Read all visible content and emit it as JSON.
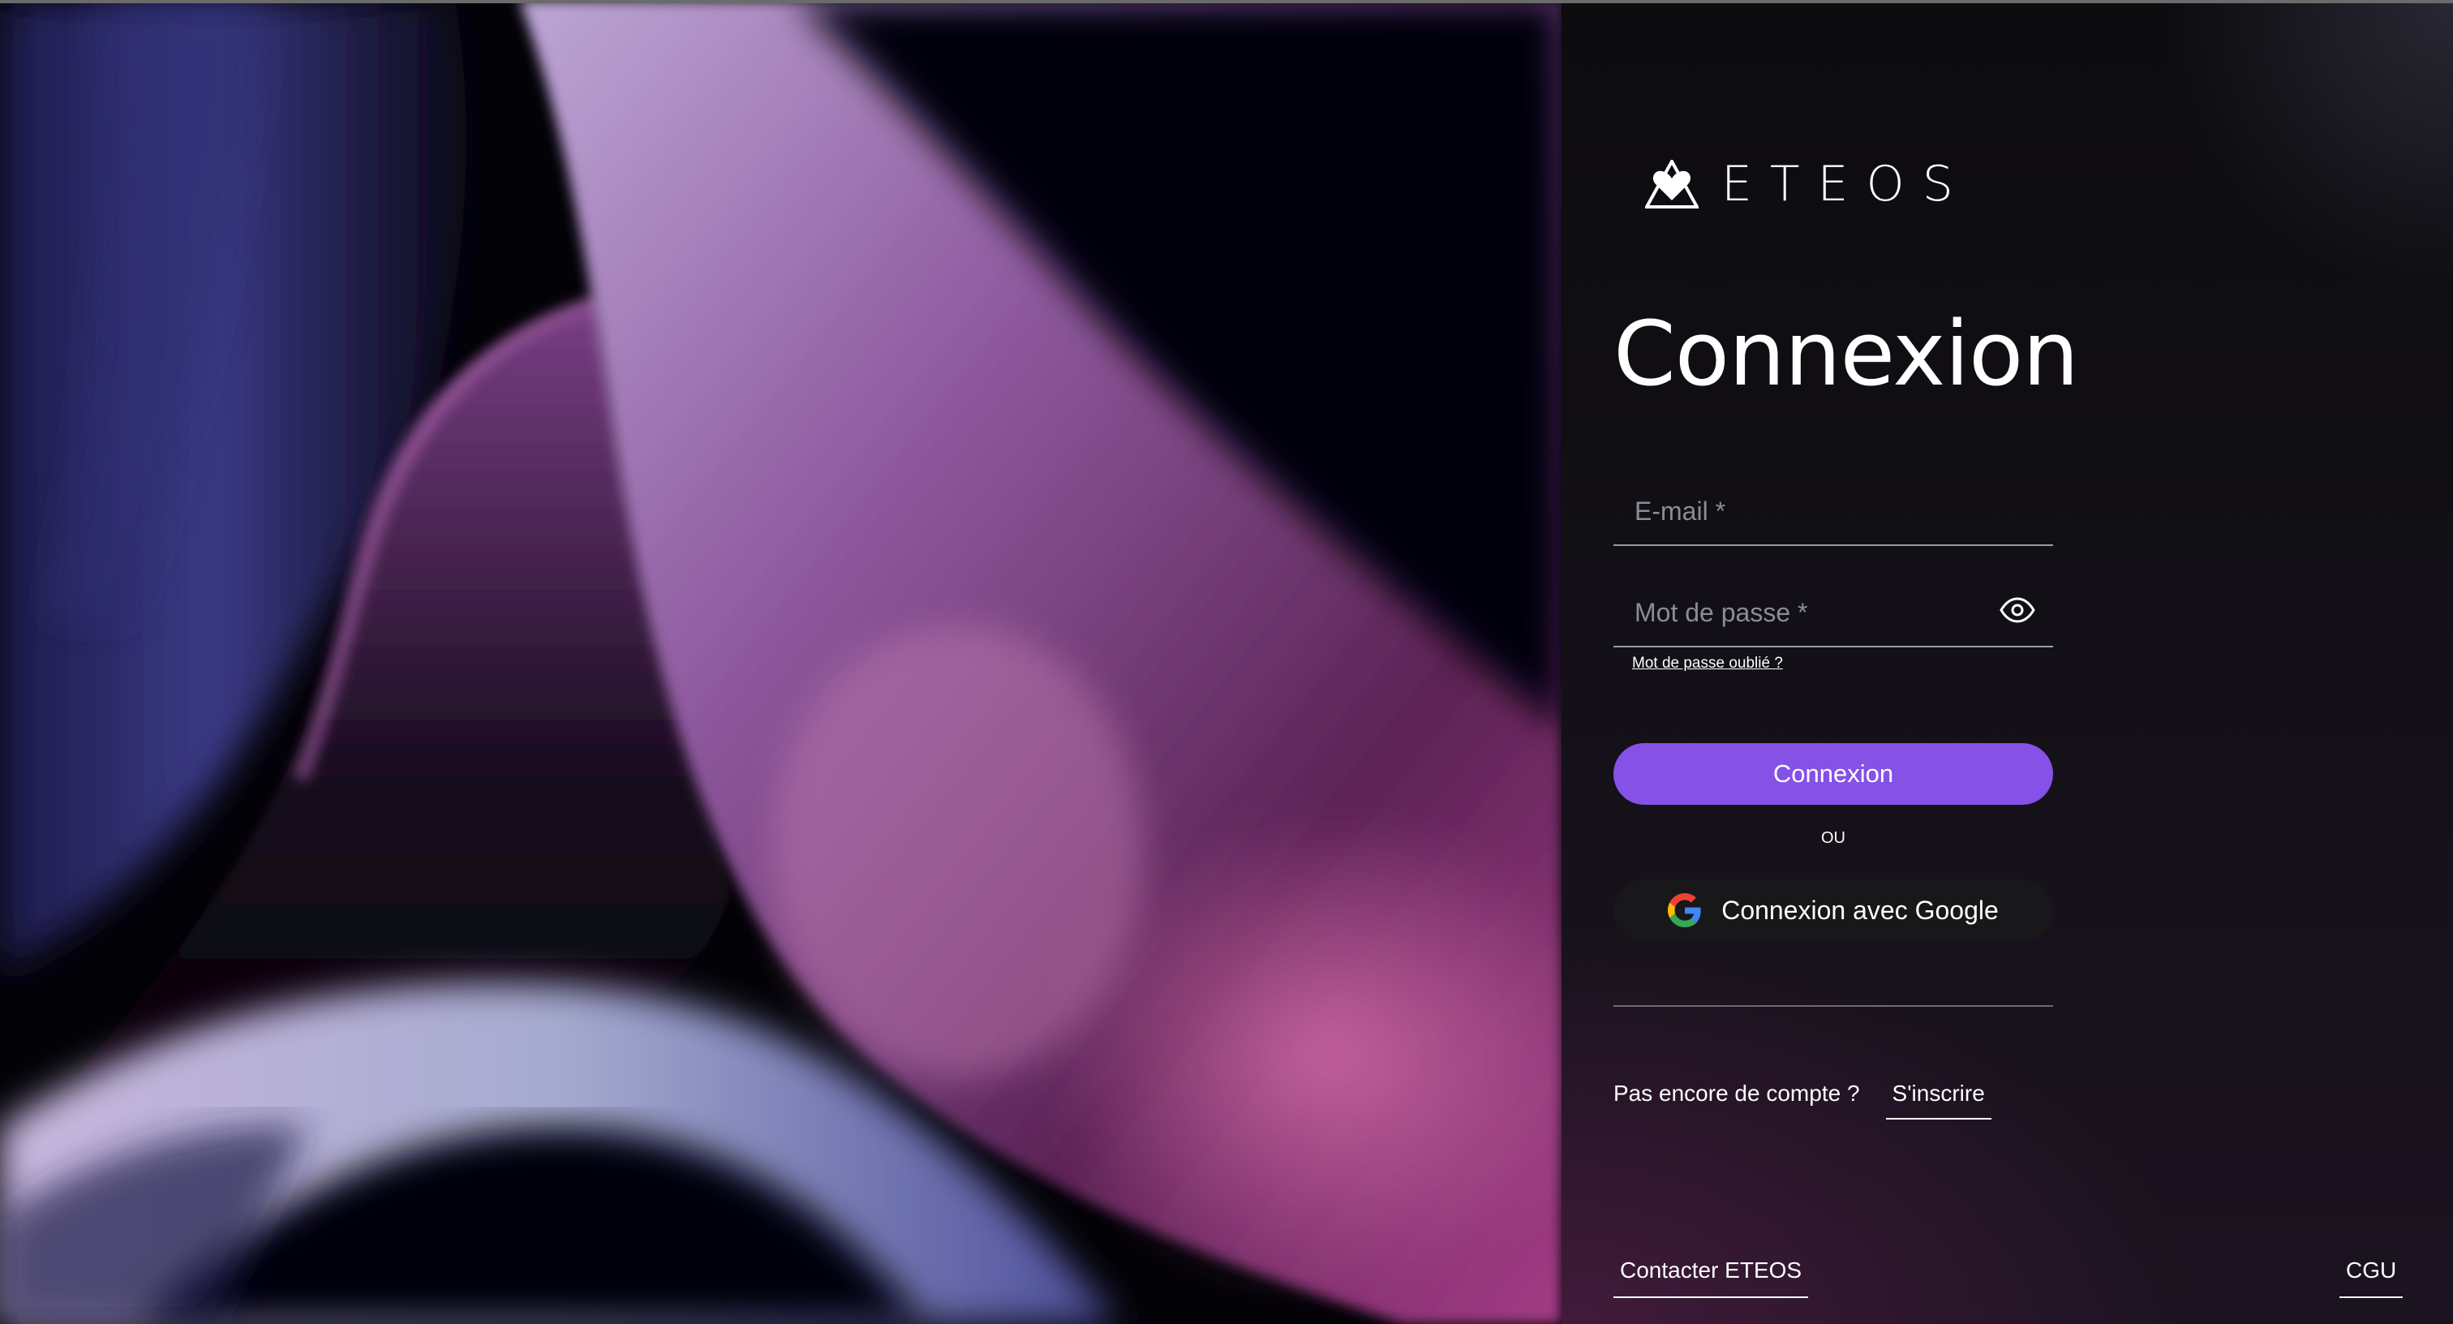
{
  "brand": {
    "name": "ETEOS",
    "logo_icon": "eteos-triangle-heart-icon"
  },
  "login": {
    "title": "Connexion",
    "email_placeholder": "E-mail *",
    "password_placeholder": "Mot de passe *",
    "password_toggle_icon": "eye-icon",
    "forgot_password": "Mot de passe oublié ?",
    "submit_label": "Connexion",
    "separator": "OU",
    "google_label": "Connexion avec Google",
    "google_icon": "google-g-icon"
  },
  "signup": {
    "question": "Pas encore de compte ?",
    "link": "S'inscrire"
  },
  "footer": {
    "contact": "Contacter ETEOS",
    "terms": "CGU"
  },
  "colors": {
    "accent": "#8551e6",
    "background": "#0c0b0e",
    "google_button": "#18171a",
    "text": "#ffffff"
  }
}
